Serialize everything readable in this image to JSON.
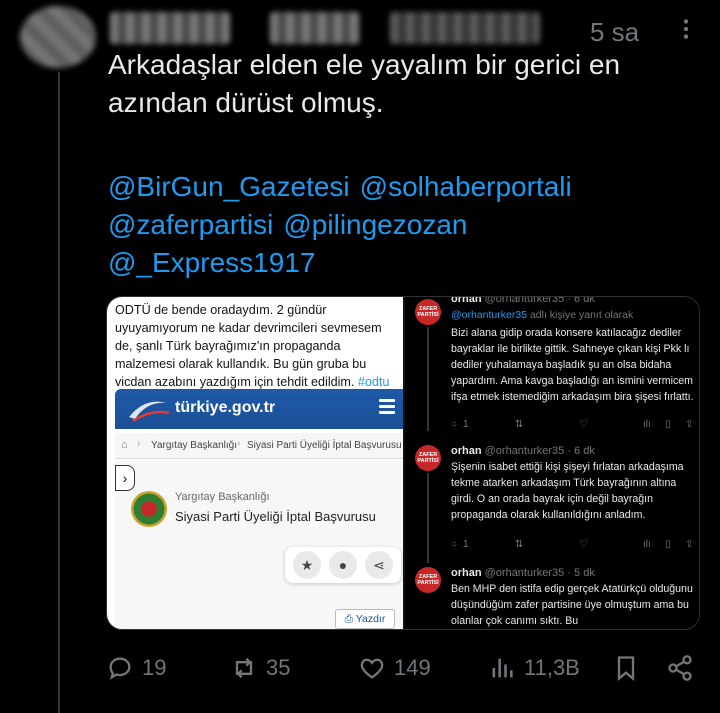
{
  "tweet": {
    "time": "5 sa",
    "text": "Arkadaşlar elden ele yayalım bir gerici en azından dürüst olmuş.",
    "mentions": [
      "@BirGun_Gazetesi",
      "@solhaberportali",
      "@zaferpartisi",
      "@pilingezozan",
      "@_Express1917"
    ]
  },
  "media_left": {
    "text": "ODTÜ de bende oradaydım. 2 gündür uyuyamıyorum ne kadar devrimcileri sevmesem de, şanlı Türk bayrağımız'ın propaganda malzemesi olarak kullandık. Bu gün gruba bu vicdan azabını yazdığım için tehdit edildim.",
    "hashtag": "#odtu",
    "gov_logo": "türkiye.gov.tr",
    "breadcrumb": [
      "Yargıtay Başkanlığı",
      "Siyasi Parti Üyeliği İptal Başvurusu"
    ],
    "institution": "Yargıtay Başkanlığı",
    "application": "Siyasi Parti Üyeliği İptal Başvurusu",
    "print_label": "Yazdır"
  },
  "media_right": {
    "replying_prefix": "@orhanturker35",
    "replying_suffix": " adlı kişiye yanıt olarak",
    "avatar_text": "ZAFER PARTİSİ",
    "replies": [
      {
        "name": "orhan",
        "handle": "@orhanturker35 · 6 dk",
        "text": "Bizi alana gidip orada konsere katılacağız dediler bayraklar ile birlikte gittik. Sahneye çıkan kişi Pkk lı dediler yuhalamaya başladık şu an olsa bidaha yapardım. Ama kavga başladığı an ismini vermicem ifşa etmek istemediğim arkadaşım bira şişesi fırlattı.",
        "replies_count": "1"
      },
      {
        "name": "orhan",
        "handle": "@orhanturker35 · 6 dk",
        "text": "Şişenin isabet ettiği kişi şişeyi fırlatan arkadaşıma tekme atarken arkadaşım Türk bayrağının altına girdi. O an orada bayrak için değil bayrağın propaganda olarak kullanıldığını anladım.",
        "replies_count": "1"
      },
      {
        "name": "orhan",
        "handle": "@orhanturker35 · 5 dk",
        "text": "Ben MHP den istifa edip gerçek Atatürkçü olduğunu düşündüğüm zafer partisine üye olmuştum ama bu olanlar çok canımı sıktı. Bu",
        "replies_count": ""
      }
    ]
  },
  "stats": {
    "replies": "19",
    "retweets": "35",
    "likes": "149",
    "views": "11,3B"
  },
  "colors": {
    "background": "#000000",
    "text": "#e7e9ea",
    "muted": "#71767b",
    "link": "#1d9bf0",
    "gov_blue": "#1e5aa8"
  },
  "icons": [
    "more-icon",
    "reply-icon",
    "retweet-icon",
    "like-icon",
    "views-icon",
    "bookmark-icon",
    "share-icon",
    "star-icon",
    "comment-icon",
    "share-node-icon",
    "print-icon",
    "home-icon"
  ]
}
